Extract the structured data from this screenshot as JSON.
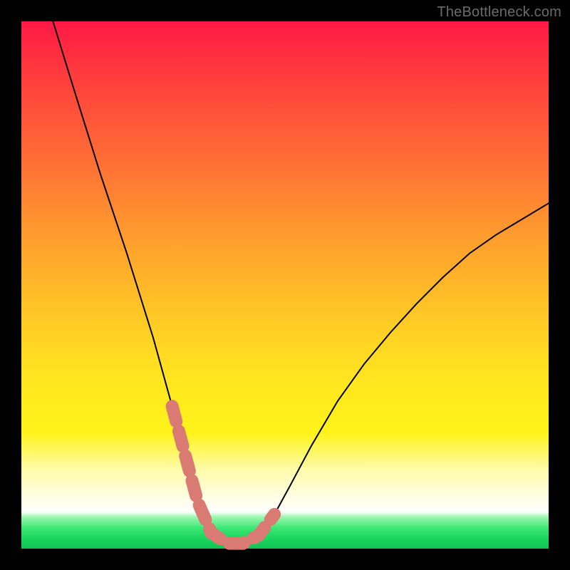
{
  "watermark": "TheBottleneck.com",
  "chart_data": {
    "type": "line",
    "title": "",
    "xlabel": "",
    "ylabel": "",
    "xlim": [
      0,
      1
    ],
    "ylim": [
      0,
      1
    ],
    "series": [
      {
        "name": "curve-main",
        "color": "#000000",
        "x": [
          0.06,
          0.1,
          0.15,
          0.2,
          0.25,
          0.286,
          0.31,
          0.334,
          0.36,
          0.39,
          0.42,
          0.45,
          0.48,
          0.51,
          0.55,
          0.6,
          0.65,
          0.7,
          0.75,
          0.8,
          0.85,
          0.9,
          0.95,
          1.0
        ],
        "values": [
          1.0,
          0.87,
          0.71,
          0.56,
          0.4,
          0.27,
          0.18,
          0.09,
          0.03,
          0.01,
          0.01,
          0.025,
          0.065,
          0.12,
          0.195,
          0.28,
          0.35,
          0.41,
          0.465,
          0.515,
          0.56,
          0.595,
          0.625,
          0.655
        ]
      },
      {
        "name": "trough-highlight",
        "color": "#d97b73",
        "x": [
          0.286,
          0.31,
          0.334,
          0.36,
          0.39,
          0.42,
          0.45,
          0.48
        ],
        "values": [
          0.27,
          0.18,
          0.09,
          0.03,
          0.01,
          0.01,
          0.025,
          0.065
        ]
      }
    ]
  }
}
